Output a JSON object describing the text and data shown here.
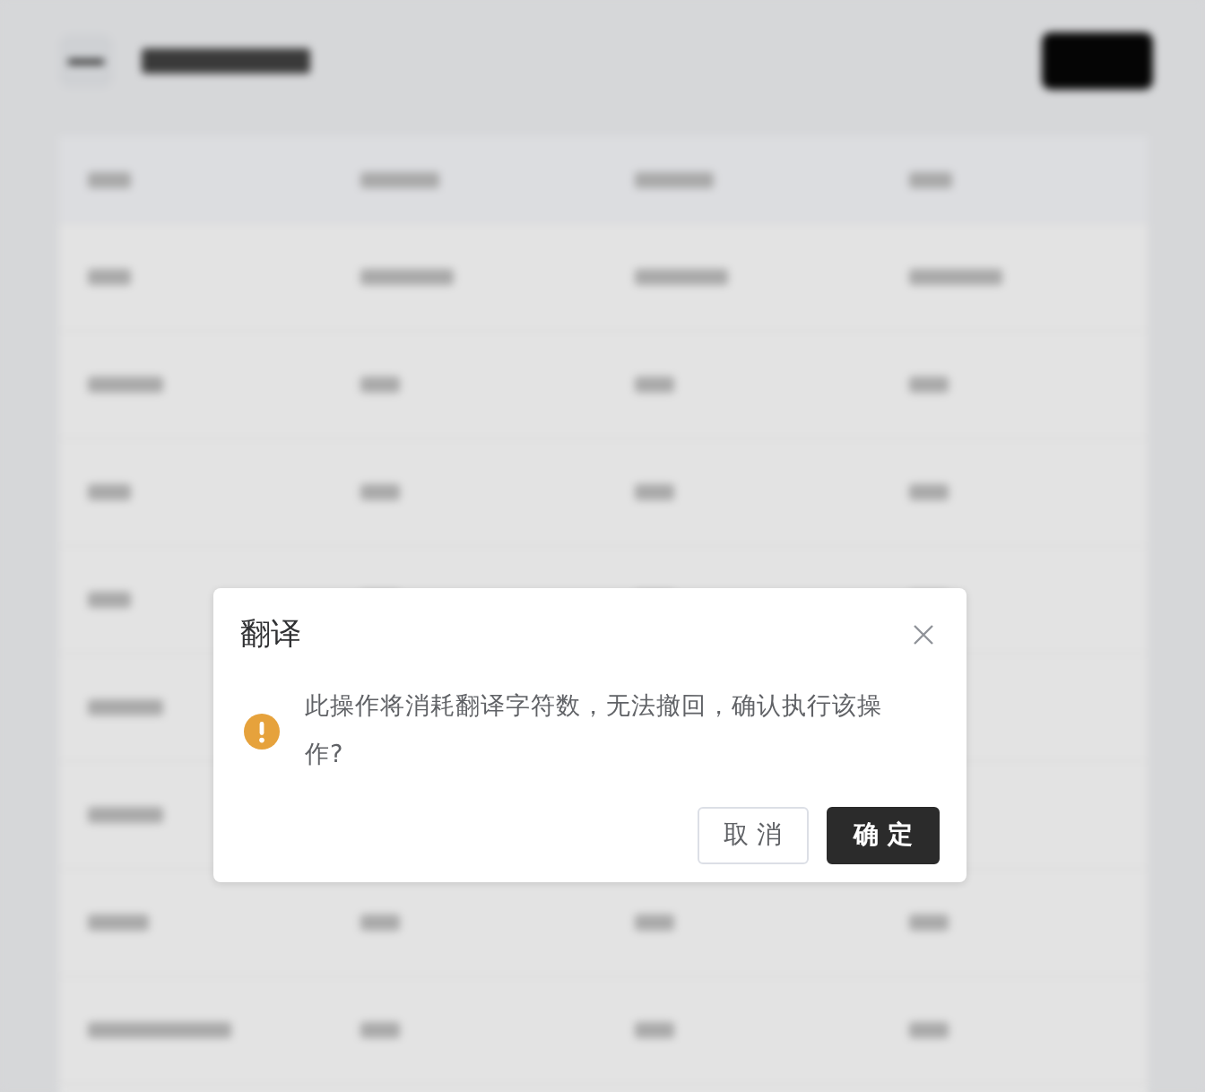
{
  "dialog": {
    "title": "翻译",
    "message": "此操作将消耗翻译字符数，无法撤回，确认执行该操作?",
    "buttons": [
      {
        "label": "取 消",
        "kind": "secondary"
      },
      {
        "label": "确 定",
        "kind": "primary"
      }
    ]
  }
}
